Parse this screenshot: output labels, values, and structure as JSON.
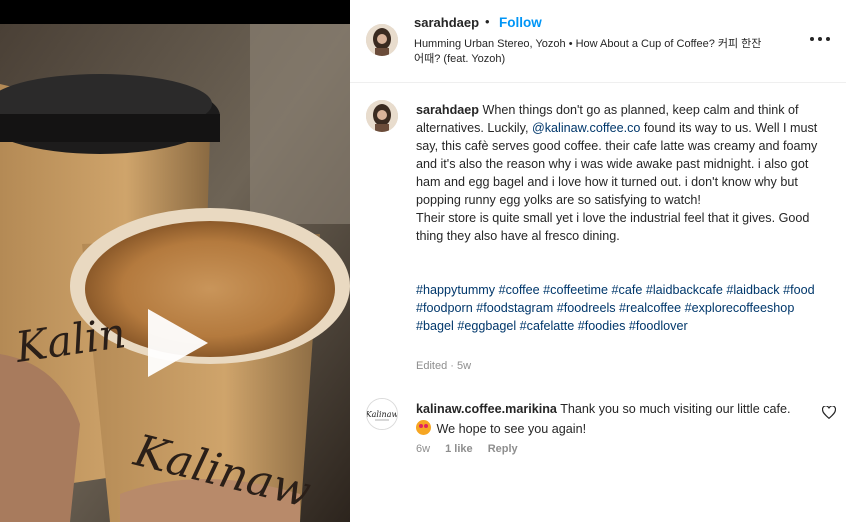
{
  "post": {
    "username": "sarahdaep",
    "separator": "•",
    "follow_label": "Follow",
    "music": "Humming Urban Stereo, Yozoh • How About a Cup of Coffee? 커피 한잔 어때? (feat. Yozoh)",
    "more_icon": "more-horizontal-icon"
  },
  "media": {
    "cup_text_front": "Kalinaw",
    "cup_text_back": "Kalin",
    "play_icon": "play-icon"
  },
  "caption": {
    "username": "sarahdaep",
    "text_before_mention": " When things don't go as planned, keep calm and think of alternatives. Luckily, ",
    "mention": "@kalinaw.coffee.co",
    "text_after_mention": " found its way to us. Well I must say, this cafè serves good coffee. their cafe latte was creamy and foamy and it's also the reason why i was wide awake past midnight. i also got ham and egg bagel and i love how it turned out. i don't know why but popping runny egg yolks are so satisfying to watch!",
    "text_2": "Their store is quite small yet i love the industrial feel that it gives. Good thing they also have al fresco dining.",
    "hashtags": "#happytummy #coffee #coffeetime #cafe #laidbackcafe #laidback #food #foodporn #foodstagram #foodreels #realcoffee #explorecoffeeshop #bagel #eggbagel #cafelatte #foodies #foodlover",
    "edited": "Edited · 5w"
  },
  "comment": {
    "username": "kalinaw.coffee.marikina",
    "text_1": " Thank you so much visiting our little cafe. ",
    "text_2": " We hope to see you again!",
    "avatar_text": "Kalinaw",
    "age": "6w",
    "likes": "1 like",
    "reply_label": "Reply",
    "like_icon": "heart-icon"
  }
}
